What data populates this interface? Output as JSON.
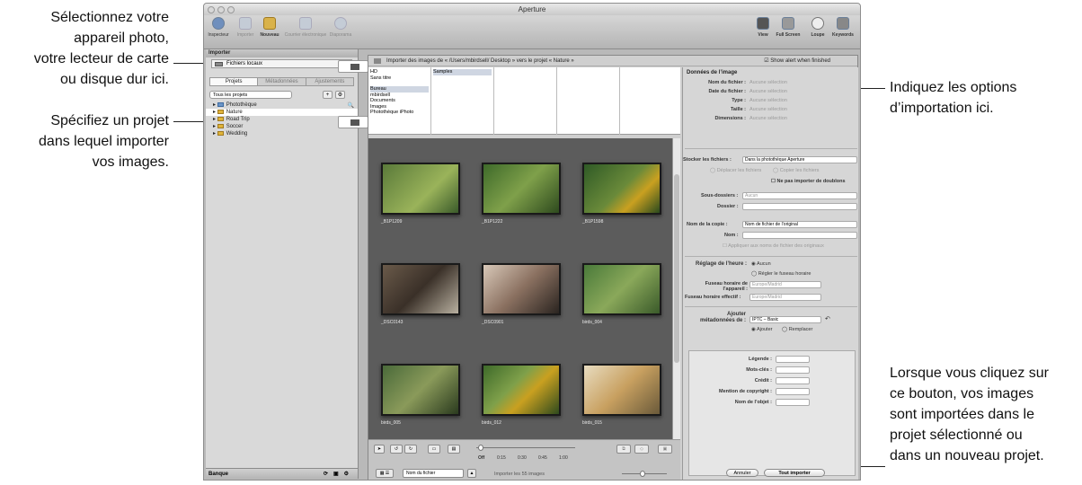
{
  "callouts": {
    "device": [
      "Sélectionnez votre",
      "appareil photo,",
      "votre lecteur de carte",
      "ou disque dur ici."
    ],
    "project": [
      "Spécifiez un projet",
      "dans lequel importer",
      "vos images."
    ],
    "options": [
      "Indiquez les options",
      "d’importation ici."
    ],
    "button": [
      "Lorsque vous cliquez sur",
      "ce bouton, vos images",
      "sont importées dans le",
      "projet sélectionné ou",
      "dans un nouveau projet."
    ]
  },
  "window": {
    "title": "Aperture"
  },
  "toolbar": {
    "left": [
      "Inspecteur",
      "Importer",
      "Nouveau",
      "Courrier électronique",
      "Diaporama"
    ],
    "right": [
      "View",
      "Full Screen",
      "Loupe",
      "Keywords"
    ]
  },
  "left_panel": {
    "header": "Importer",
    "source": "Fichiers locaux",
    "tabs": [
      "Projets",
      "Métadonnées",
      "Ajustements"
    ],
    "filter": "Tous les projets",
    "projects": [
      "Photothèque",
      "Nature",
      "Road Trip",
      "Soccer",
      "Wedding"
    ],
    "footer": "Banque"
  },
  "main": {
    "header": "Importer des images de « /Users/mbirdsell/ Desktop » vers le projet « Nature »",
    "show_alert": "Show alert when finished",
    "browser_col1": [
      "HD",
      "Sans titre",
      "",
      "Bureau",
      "mbirdsell",
      "Documents",
      "Images",
      "Photothèque iPhoto"
    ],
    "browser_col2": [
      "Samples"
    ],
    "thumbnails": [
      "_B1P1209",
      "_B1P1222",
      "_B1P1598",
      "_DSC0143",
      "_DSC0901",
      "birds_004",
      "birds_005",
      "birds_012",
      "birds_015"
    ],
    "timeline": [
      "Off",
      "0:15",
      "0:30",
      "0:45",
      "1:00"
    ],
    "sort": "Nom du fichier",
    "status": "Importer les 55 images"
  },
  "right_panel": {
    "title": "Données de l’image",
    "info_rows": [
      {
        "label": "Nom du fichier :",
        "value": "Aucune sélection"
      },
      {
        "label": "Date du fichier :",
        "value": "Aucune sélection"
      },
      {
        "label": "Type :",
        "value": "Aucune sélection"
      },
      {
        "label": "Taille :",
        "value": "Aucune sélection"
      },
      {
        "label": "Dimensions :",
        "value": "Aucune sélection"
      }
    ],
    "store_label": "Stocker les fichiers :",
    "store_value": "Dans la photothèque Aperture",
    "move": "Déplacer les fichiers",
    "copy": "Copier les fichiers",
    "no_dup": "Ne pas importer de doublons",
    "subfolders_label": "Sous-dossiers :",
    "subfolders_value": "Aucun",
    "folder_label": "Dossier :",
    "copy_name_label": "Nom de la copie :",
    "copy_name_value": "Nom de fichier de l’original",
    "name_label": "Nom :",
    "apply_names": "Appliquer aux noms de fichier des originaux",
    "time_label": "Réglage de l’heure :",
    "time_none": "Aucun",
    "time_tz": "Régler le fuseau horaire",
    "tz_camera_label": "Fuseau horaire de l’appareil :",
    "tz_camera_value": "Europe/Madrid",
    "tz_effective_label": "Fuseau horaire effectif :",
    "tz_effective_value": "Europe/Madrid",
    "meta_label": "Ajouter métadonnées de :",
    "meta_value": "IPTC – Basic",
    "add": "Ajouter",
    "replace": "Remplacer",
    "iptc_fields": [
      "Légende :",
      "Mots-clés :",
      "Crédit :",
      "Mention de copyright :",
      "Nom de l’objet :"
    ],
    "cancel": "Annuler",
    "import_all": "Tout importer"
  }
}
